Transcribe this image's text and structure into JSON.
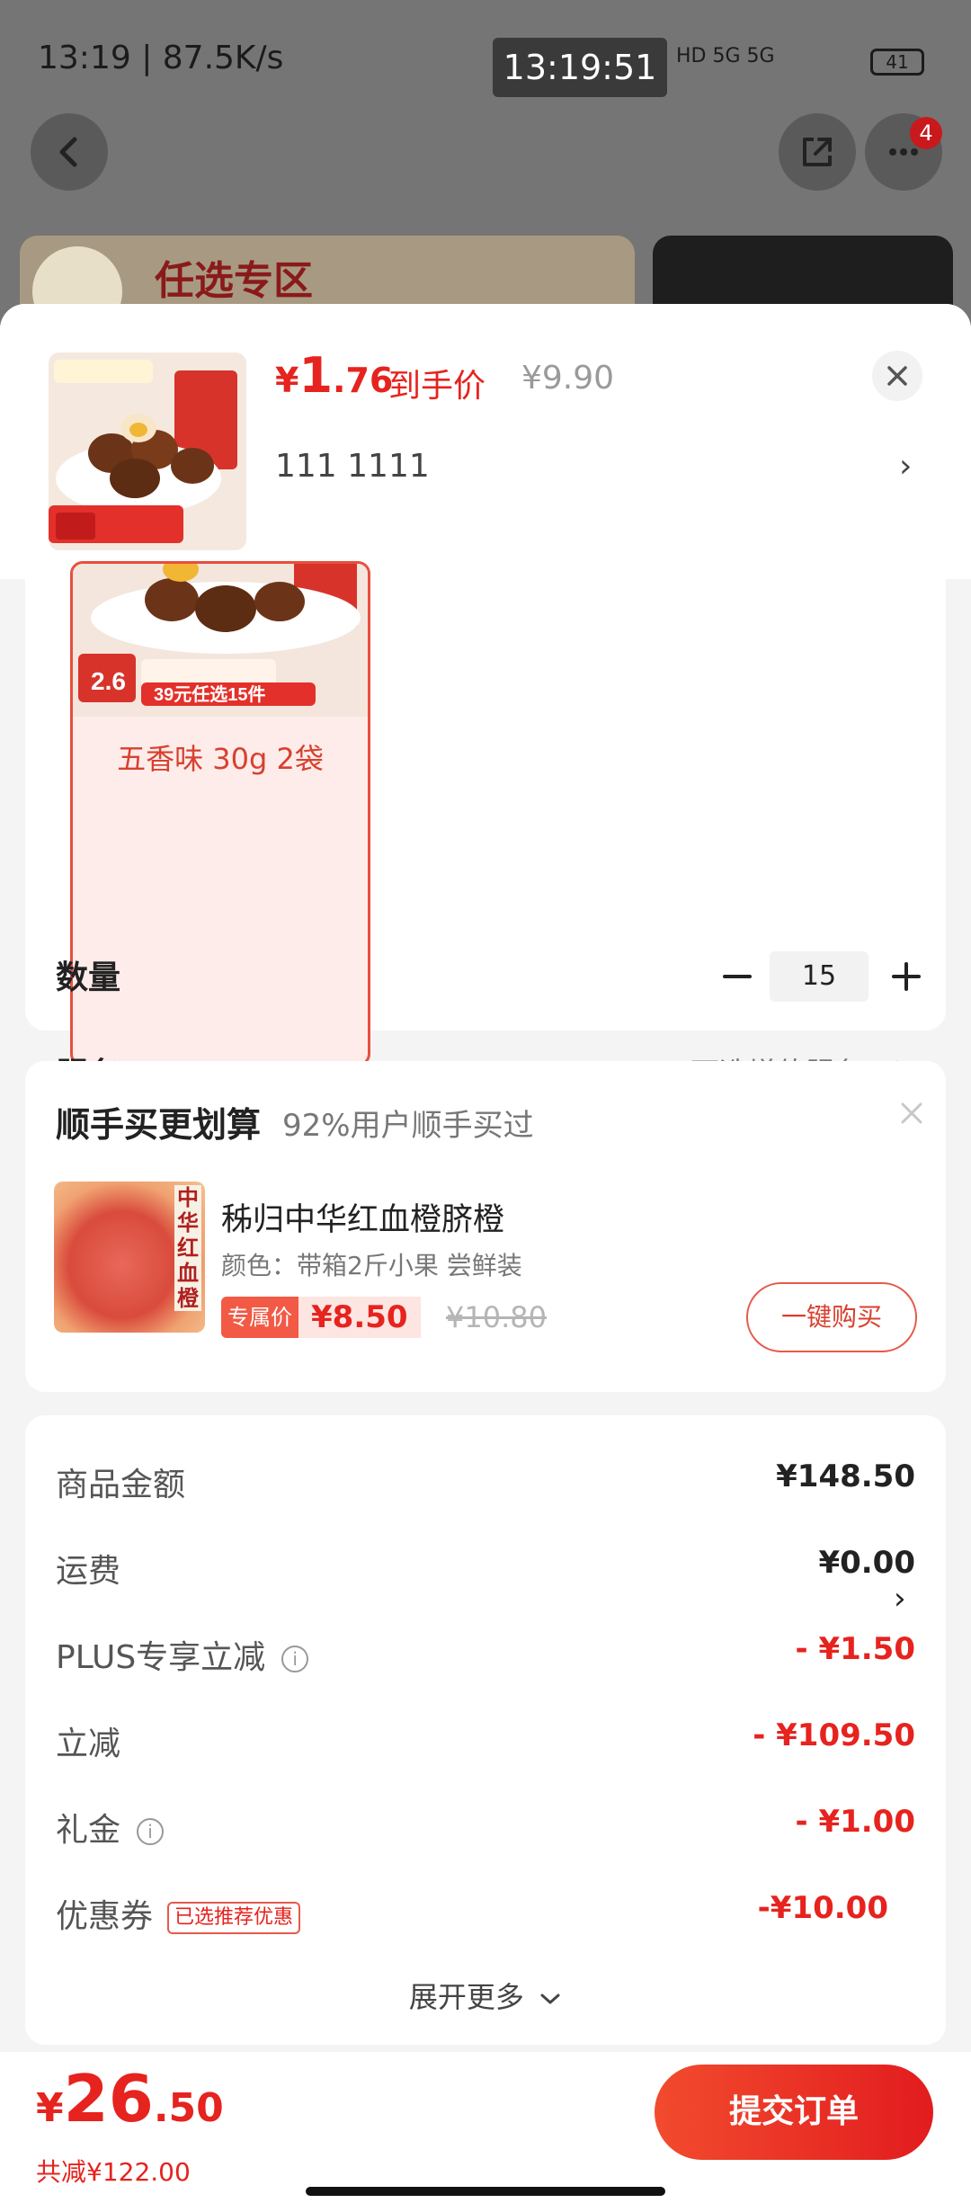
{
  "status_bar": {
    "time": "13:19 | 87.5K/s",
    "clock": "13:19:51",
    "signal": "HD 5G 5G",
    "battery": "41"
  },
  "nav": {
    "badge_count": "4"
  },
  "background": {
    "banner_text": "任选专区"
  },
  "sheet": {
    "price_symbol": "¥",
    "price_int": "1",
    "price_dec": ".76",
    "price_label": "到手价",
    "original_price": "¥9.90",
    "selected_spec": "111  1111",
    "spec_arrow": "›"
  },
  "variant": {
    "label": "五香味 30g 2袋",
    "badge_text": "2.6",
    "promo_text": "39元任选15件"
  },
  "quantity": {
    "label": "数量",
    "value": "15"
  },
  "service": {
    "label": "服务",
    "hint": "可选增值服务",
    "arrow": "›"
  },
  "recommend": {
    "title": "顺手买更划算",
    "subtitle": "92%用户顺手买过",
    "product_name": "秭归中华红血橙脐橙",
    "product_color": "颜色：带箱2斤小果 尝鲜装",
    "image_tag": "中华红血橙",
    "price_tag": "专属价",
    "price": "¥8.50",
    "original_price": "¥10.80",
    "buy_button": "一键购买"
  },
  "summary": {
    "rows": [
      {
        "label": "商品金额",
        "value": "¥148.50"
      },
      {
        "label": "运费",
        "value": "¥0.00"
      },
      {
        "label": "PLUS专享立减",
        "value": "- ¥1.50"
      },
      {
        "label": "立减",
        "value": "- ¥109.50"
      },
      {
        "label": "礼金",
        "value": "- ¥1.00"
      },
      {
        "label": "优惠券",
        "value": "-¥10.00",
        "tag": "已选推荐优惠"
      }
    ],
    "expand_label": "展开更多"
  },
  "bottom": {
    "total_symbol": "¥",
    "total_int": "26",
    "total_dec": ".50",
    "saved": "共减¥122.00",
    "submit_label": "提交订单"
  },
  "colors": {
    "accent": "#e6231e",
    "overlay": "#757575"
  }
}
